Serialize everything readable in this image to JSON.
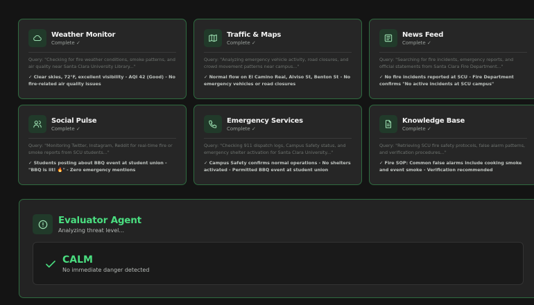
{
  "agents": [
    {
      "title": "Weather Monitor",
      "icon": "cloud-icon",
      "status": "Complete ✓",
      "query": "Query: \"Checking for fire weather conditions, smoke patterns, and air quality near Santa Clara University Library...\"",
      "result": "✓ Clear skies, 72°F, excellent visibility - AQI 42 (Good) - No fire-related air quality issues"
    },
    {
      "title": "Traffic & Maps",
      "icon": "map-icon",
      "status": "Complete ✓",
      "query": "Query: \"Analyzing emergency vehicle activity, road closures, and crowd movement patterns near campus...\"",
      "result": "✓ Normal flow on El Camino Real, Alviso St, Benton St - No emergency vehicles or road closures"
    },
    {
      "title": "News Feed",
      "icon": "newspaper-icon",
      "status": "Complete ✓",
      "query": "Query: \"Searching for fire incidents, emergency reports, and official statements from Santa Clara Fire Department...\"",
      "result": "✓ No fire incidents reported at SCU - Fire Department confirms \"No active incidents at SCU campus\""
    },
    {
      "title": "Social Pulse",
      "icon": "users-icon",
      "status": "Complete ✓",
      "query": "Query: \"Monitoring Twitter, Instagram, Reddit for real-time fire or smoke reports from SCU students...\"",
      "result": "✓ Students posting about BBQ event at student union - \"BBQ is lit! 🔥\" - Zero emergency mentions"
    },
    {
      "title": "Emergency Services",
      "icon": "phone-icon",
      "status": "Complete ✓",
      "query": "Query: \"Checking 911 dispatch logs, Campus Safety status, and emergency shelter activation for Santa Clara University...\"",
      "result": "✓ Campus Safety confirms normal operations - No shelters activated - Permitted BBQ event at student union"
    },
    {
      "title": "Knowledge Base",
      "icon": "document-icon",
      "status": "Complete ✓",
      "query": "Query: \"Retrieving SCU fire safety protocols, false alarm patterns, and verification procedures...\"",
      "result": "✓ Fire SOP: Common false alarms include cooking smoke and event smoke - Verification recommended"
    }
  ],
  "evaluator": {
    "title": "Evaluator Agent",
    "subtitle": "Analyzing threat level...",
    "icon": "alert-circle-icon",
    "verdict_label": "CALM",
    "verdict_desc": "No immediate danger detected",
    "verdict_icon": "check-icon"
  },
  "colors": {
    "accent": "#4ade80",
    "card_border": "#2f6b40",
    "background": "#141414"
  }
}
